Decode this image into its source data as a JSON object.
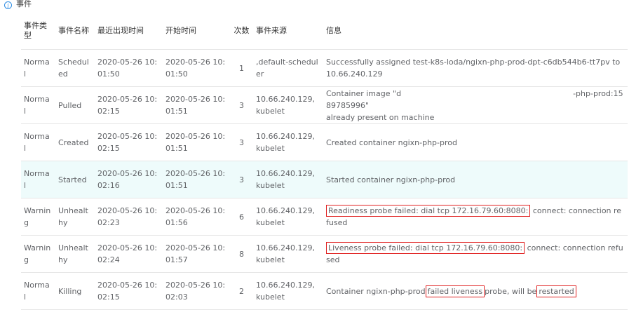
{
  "section": {
    "title": "事件",
    "icon": "info-icon"
  },
  "columns": [
    "事件类型",
    "事件名称",
    "最近出现时间",
    "开始时间",
    "次数",
    "事件来源",
    "信息"
  ],
  "rows": [
    {
      "type": "Normal",
      "name": "Scheduled",
      "last": "2020-05-26 10:01:50",
      "first": "2020-05-26 10:01:50",
      "count": "1",
      "source": ",default-scheduler",
      "message": "Successfully assigned test-k8s-loda/ngixn-php-prod-dpt-c6db544b6-tt7pv to 10.66.240.129"
    },
    {
      "type": "Normal",
      "name": "Pulled",
      "last": "2020-05-26 10:02:15",
      "first": "2020-05-26 10:01:51",
      "count": "3",
      "source": "10.66.240.129,kubelet",
      "message_a": "Container image \"d",
      "message_b": "-php-prod:1589785996\"",
      "message_c": "already present on machine"
    },
    {
      "type": "Normal",
      "name": "Created",
      "last": "2020-05-26 10:02:15",
      "first": "2020-05-26 10:01:51",
      "count": "3",
      "source": "10.66.240.129,kubelet",
      "message": "Created container ngixn-php-prod"
    },
    {
      "type": "Normal",
      "name": "Started",
      "last": "2020-05-26 10:02:16",
      "first": "2020-05-26 10:01:51",
      "count": "3",
      "source": "10.66.240.129,kubelet",
      "message": "Started container ngixn-php-prod"
    },
    {
      "type": "Warning",
      "name": "Unhealthy",
      "last": "2020-05-26 10:02:23",
      "first": "2020-05-26 10:01:56",
      "count": "6",
      "source": "10.66.240.129,kubelet",
      "message_hl": "Readiness probe failed: dial tcp 172.16.79.60:8080:",
      "message_rest": " connect: connection refused"
    },
    {
      "type": "Warning",
      "name": "Unhealthy",
      "last": "2020-05-26 10:02:24",
      "first": "2020-05-26 10:01:57",
      "count": "8",
      "source": "10.66.240.129,kubelet",
      "message_hl": "Liveness probe failed: dial tcp 172.16.79.60:8080:",
      "message_rest": " connect: connection refused"
    },
    {
      "type": "Normal",
      "name": "Killing",
      "last": "2020-05-26 10:02:15",
      "first": "2020-05-26 10:02:03",
      "count": "2",
      "source": "10.66.240.129,kubelet",
      "message_a": "Container ngixn-php-prod",
      "message_hl1": "failed liveness",
      "message_b": "probe, will be",
      "message_hl2": "restarted"
    }
  ],
  "colors": {
    "highlight_row": "#eefbfb",
    "annotation_box": "#e02020",
    "accent": "#2f8de4"
  }
}
